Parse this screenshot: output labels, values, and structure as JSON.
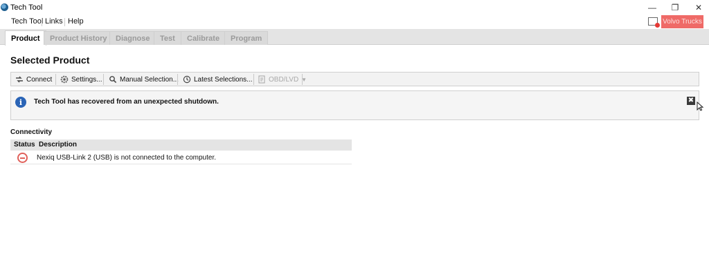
{
  "window": {
    "title": "Tech Tool",
    "controls": {
      "minimize": "—",
      "restore": "❐",
      "close": "✕"
    }
  },
  "menu": {
    "items": [
      "Tech Tool",
      "Links",
      "Help"
    ],
    "brand_button": "Volvo Trucks"
  },
  "tabs": [
    {
      "label": "Product",
      "active": true
    },
    {
      "label": "Product History",
      "active": false
    },
    {
      "label": "Diagnose",
      "active": false
    },
    {
      "label": "Test",
      "active": false
    },
    {
      "label": "Calibrate",
      "active": false
    },
    {
      "label": "Program",
      "active": false
    }
  ],
  "page": {
    "title": "Selected Product"
  },
  "toolbar": {
    "connect": "Connect",
    "settings": "Settings...",
    "manual_selection": "Manual Selection...",
    "latest_selections": "Latest Selections...",
    "obd_lvd": "OBD/LVD"
  },
  "info": {
    "message": "Tech Tool has recovered from an unexpected shutdown.",
    "close_glyph": "✖"
  },
  "connectivity": {
    "title": "Connectivity",
    "columns": [
      "Status",
      "Description"
    ],
    "rows": [
      {
        "status": "not-connected",
        "description": "Nexiq USB-Link 2 (USB) is not connected to the computer."
      }
    ]
  },
  "colors": {
    "brand": "#ef6a67",
    "error": "#e0605a",
    "info": "#2a64b6"
  }
}
